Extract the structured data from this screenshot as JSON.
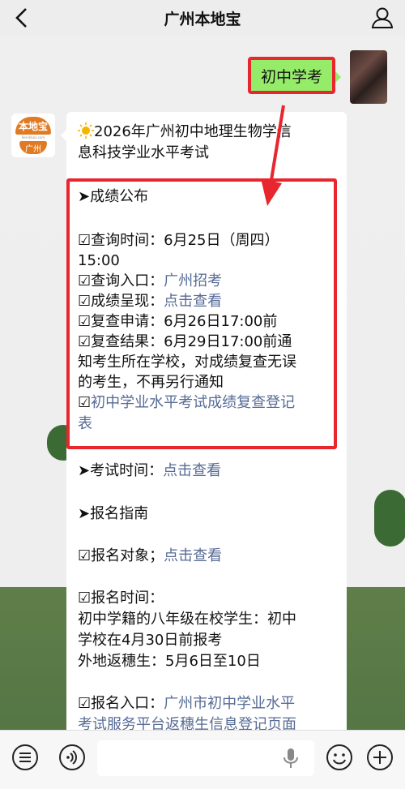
{
  "header": {
    "title": "广州本地宝"
  },
  "sent_message": {
    "text": "初中学考"
  },
  "bot": {
    "logo_top": "本地宝",
    "logo_url": "Bendibao.com",
    "logo_city": "广州"
  },
  "message": {
    "title_line1": "2026年广州初中地理生物学信",
    "title_line2": "息科技学业水平考试",
    "section_scores": "➤成绩公布",
    "query_time_1": "☑查询时间：6月25日（周四）",
    "query_time_2": "15:00",
    "query_entry_label": "☑查询入口：",
    "query_entry_link": "广州招考",
    "score_view_label": "☑成绩呈现：",
    "score_view_link": "点击查看",
    "recheck_apply": "☑复查申请：6月26日17:00前",
    "recheck_result_1": "☑复查结果：6月29日17:00前通",
    "recheck_result_2": "知考生所在学校，对成绩复查无误",
    "recheck_result_3": "的考生，不再另行通知",
    "recheck_form_prefix": "☑",
    "recheck_form_link_1": "初中学业水平考试成绩复查登记",
    "recheck_form_link_2": "表",
    "exam_time_label": "➤考试时间：",
    "exam_time_link": "点击查看",
    "section_register": "➤报名指南",
    "register_target_label": "☑报名对象；",
    "register_target_link": "点击查看",
    "register_time_label": "☑报名时间：",
    "register_time_1": "初中学籍的八年级在校学生：初中",
    "register_time_2": "学校在4月30日前报考",
    "register_time_3": "外地返穗生：5月6日至10日",
    "register_entry_label": "☑报名入口：",
    "register_entry_link_1": "广州市初中学业水平",
    "register_entry_link_2": "考试服务平台返穗生信息登记页面"
  },
  "colors": {
    "sent_bubble": "#95ec69",
    "highlight": "#e8262e",
    "link": "#576b95",
    "brand_orange": "#e07a23"
  },
  "icons": {
    "back": "chevron-left-icon",
    "profile": "person-icon",
    "menu": "list-icon",
    "voice": "voice-icon",
    "mic": "mic-icon",
    "emoji": "emoji-icon",
    "add": "plus-icon"
  }
}
